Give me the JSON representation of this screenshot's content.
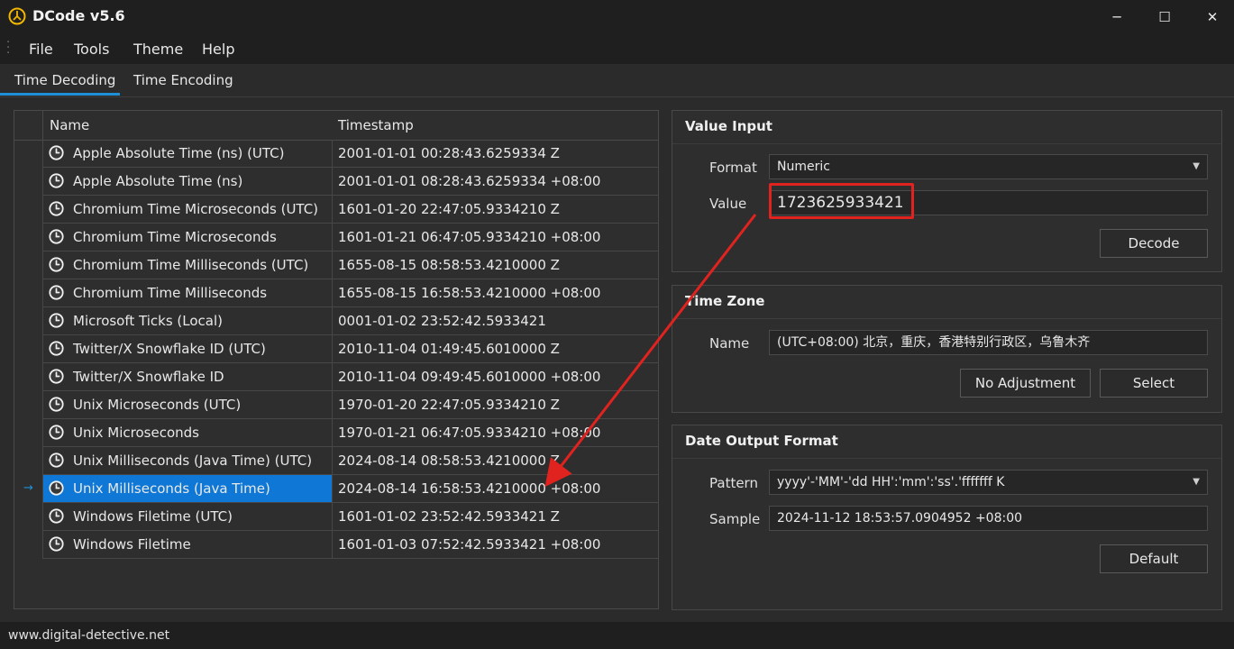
{
  "window": {
    "title": "DCode v5.6",
    "minimize_glyph": "─",
    "maximize_glyph": "☐",
    "close_glyph": "✕"
  },
  "menu": {
    "items": [
      "File",
      "Tools",
      "Theme",
      "Help"
    ]
  },
  "tabs": [
    {
      "label": "Time Decoding",
      "active": true
    },
    {
      "label": "Time Encoding",
      "active": false
    }
  ],
  "grid": {
    "columns": [
      "Name",
      "Timestamp"
    ],
    "row_icon": "clock-icon",
    "selected_marker": "→",
    "rows": [
      {
        "name": "Apple Absolute Time (ns) (UTC)",
        "timestamp": "2001-01-01 00:28:43.6259334 Z"
      },
      {
        "name": "Apple Absolute Time (ns)",
        "timestamp": "2001-01-01 08:28:43.6259334 +08:00"
      },
      {
        "name": "Chromium Time Microseconds (UTC)",
        "timestamp": "1601-01-20 22:47:05.9334210 Z"
      },
      {
        "name": "Chromium Time Microseconds",
        "timestamp": "1601-01-21 06:47:05.9334210 +08:00"
      },
      {
        "name": "Chromium Time Milliseconds (UTC)",
        "timestamp": "1655-08-15 08:58:53.4210000 Z"
      },
      {
        "name": "Chromium Time Milliseconds",
        "timestamp": "1655-08-15 16:58:53.4210000 +08:00"
      },
      {
        "name": "Microsoft Ticks (Local)",
        "timestamp": "0001-01-02 23:52:42.5933421"
      },
      {
        "name": "Twitter/X Snowflake ID (UTC)",
        "timestamp": "2010-11-04 01:49:45.6010000 Z"
      },
      {
        "name": "Twitter/X Snowflake ID",
        "timestamp": "2010-11-04 09:49:45.6010000 +08:00"
      },
      {
        "name": "Unix Microseconds (UTC)",
        "timestamp": "1970-01-20 22:47:05.9334210 Z"
      },
      {
        "name": "Unix Microseconds",
        "timestamp": "1970-01-21 06:47:05.9334210 +08:00"
      },
      {
        "name": "Unix Milliseconds (Java Time) (UTC)",
        "timestamp": "2024-08-14 08:58:53.4210000 Z"
      },
      {
        "name": "Unix Milliseconds (Java Time)",
        "timestamp": "2024-08-14 16:58:53.4210000 +08:00",
        "selected": true
      },
      {
        "name": "Windows Filetime (UTC)",
        "timestamp": "1601-01-02 23:52:42.5933421 Z"
      },
      {
        "name": "Windows Filetime",
        "timestamp": "1601-01-03 07:52:42.5933421 +08:00"
      }
    ]
  },
  "value_input": {
    "title": "Value Input",
    "format_label": "Format",
    "format_value": "Numeric",
    "value_label": "Value",
    "value": "1723625933421",
    "decode_button": "Decode"
  },
  "time_zone": {
    "title": "Time Zone",
    "name_label": "Name",
    "name_value": "(UTC+08:00) 北京，重庆，香港特别行政区，乌鲁木齐",
    "no_adjustment_button": "No Adjustment",
    "select_button": "Select"
  },
  "date_output": {
    "title": "Date Output Format",
    "pattern_label": "Pattern",
    "pattern_value": "yyyy'-'MM'-'dd HH':'mm':'ss'.'fffffff K",
    "sample_label": "Sample",
    "sample_value": "2024-11-12 18:53:57.0904952 +08:00",
    "default_button": "Default"
  },
  "status": {
    "text": "www.digital-detective.net"
  },
  "colors": {
    "selection": "#0f78d6",
    "accent": "#1e90d8",
    "annotation": "#e0231f"
  }
}
